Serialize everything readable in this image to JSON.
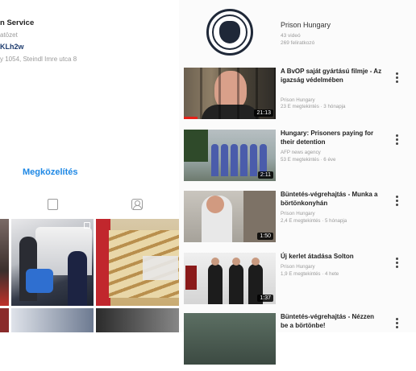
{
  "profile": {
    "name": "n Service",
    "category": "atözet",
    "link": "KLh2w",
    "address": "y 1054, Steindl Imre utca 8",
    "directions_label": "Megközelítés",
    "tabs": [
      "posts-tab",
      "tagged-tab"
    ]
  },
  "channel": {
    "name": "Prison Hungary",
    "videos": "43 videó",
    "subscribers": "269 feliratkozó"
  },
  "videos": [
    {
      "title": "A BvOP saját gyártású filmje - Az igazság védelmében",
      "channel": "Prison Hungary",
      "meta": "23 E megtekintés · 3 hónapja",
      "duration": "21:13",
      "progress": 0.15
    },
    {
      "title": "Hungary: Prisoners paying for their detention",
      "channel": "AFP news agency",
      "meta": "53 E megtekintés · 6 éve",
      "duration": "2:11",
      "progress": 0
    },
    {
      "title": "Büntetés-végrehajtás - Munka a börtönkonyhán",
      "channel": "Prison Hungary",
      "meta": "2,4 E megtekintés · 5 hónapja",
      "duration": "1:50",
      "progress": 0
    },
    {
      "title": "Új kerlet átadása Solton",
      "channel": "Prison Hungary",
      "meta": "1,9 E megtekintés · 4 hete",
      "duration": "1:37",
      "progress": 0
    },
    {
      "title": "Büntetés-végrehajtás - Nézzen be a börtönbe!",
      "channel": "",
      "meta": "",
      "duration": "",
      "progress": 0
    }
  ],
  "colors": {
    "accent_blue": "#1e88e5",
    "progress_red": "#e62117"
  }
}
